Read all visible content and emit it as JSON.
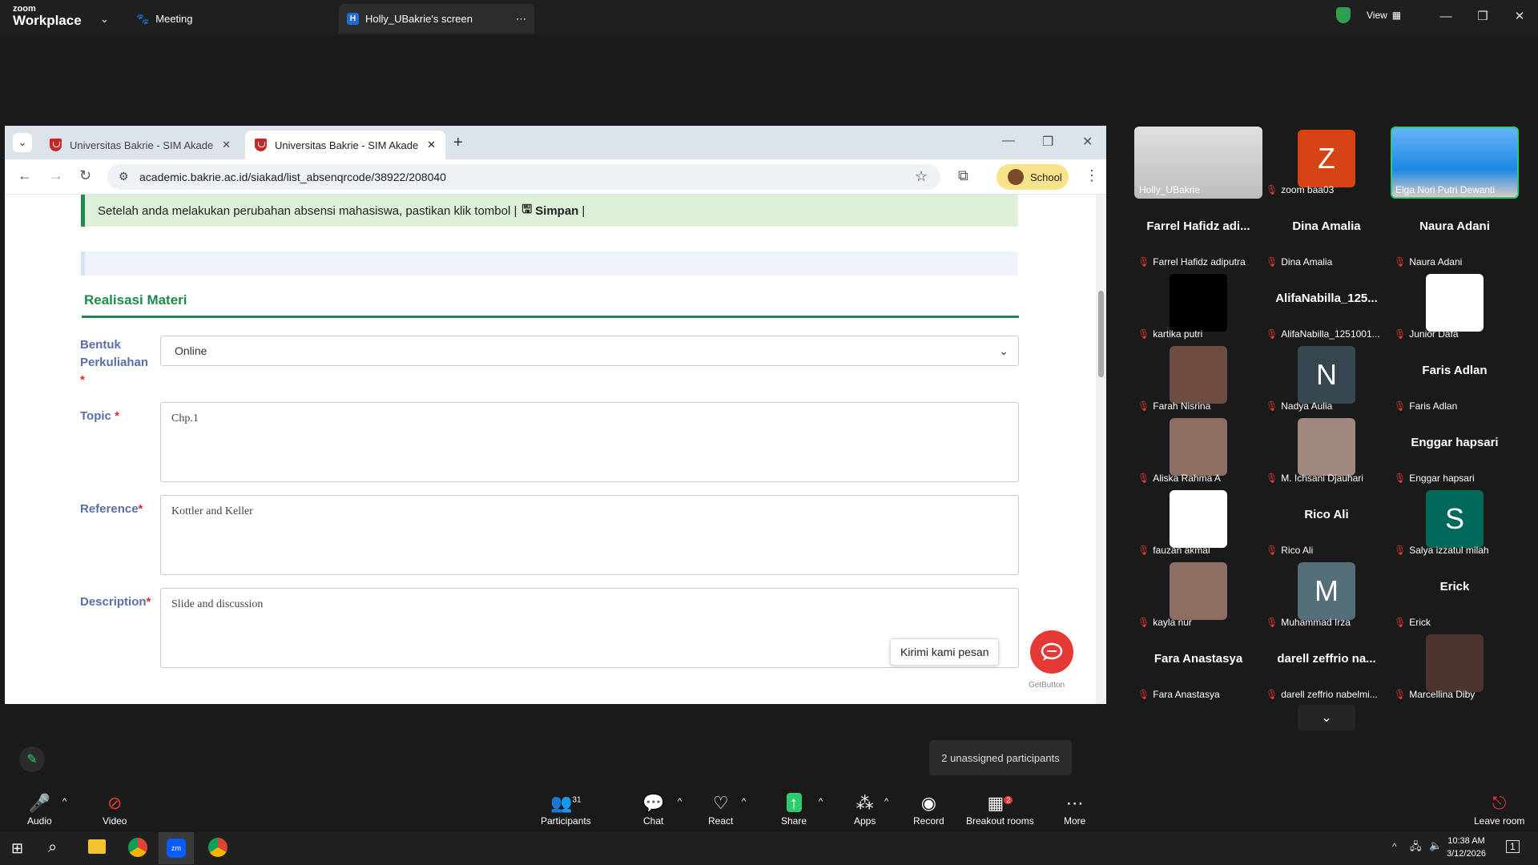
{
  "zoom": {
    "logo_small": "zoom",
    "logo_big": "Workplace",
    "meeting_tab": "Meeting",
    "screen_tab": "Holly_UBakrie's screen",
    "screen_badge": "H",
    "view_label": "View"
  },
  "browser": {
    "tabs": [
      {
        "label": "Universitas Bakrie - SIM Akaden"
      },
      {
        "label": "Universitas Bakrie - SIM Akaden"
      }
    ],
    "url": "academic.bakrie.ac.id/siakad/list_absenqrcode/38922/208040",
    "profile_label": "School"
  },
  "page": {
    "alert_text": "Setelah anda melakukan perubahan absensi mahasiswa, pastikan klik tombol |",
    "alert_button": "Simpan",
    "alert_tail": "|",
    "section_title": "Realisasi Materi",
    "fields": {
      "bentuk_label_1": "Bentuk",
      "bentuk_label_2": "Perkuliahan",
      "bentuk_value": "Online",
      "topic_label": "Topic",
      "topic_value": "Chp.1",
      "reference_label": "Reference",
      "reference_value": "Kottler and Keller",
      "description_label": "Description",
      "description_value": "Slide and discussion",
      "required_mark": "*"
    },
    "chat_tooltip": "Kirimi kami pesan",
    "getbutton_label": "GetButton"
  },
  "participants_gallery": [
    {
      "name": "Holly_UBakrie",
      "tile": "video"
    },
    {
      "name": "zoom baa03",
      "tile": "avatar",
      "letter": "Z",
      "color": "#d84315"
    },
    {
      "name": "Elga Nori Putri Dewanti",
      "tile": "video"
    },
    {
      "name": "Farrel Hafidz adiputra",
      "display": "Farrel  Hafidz adi..."
    },
    {
      "name": "Dina Amalia",
      "display": "Dina Amalia"
    },
    {
      "name": "Naura Adani",
      "display": "Naura Adani"
    },
    {
      "name": "kartika putri",
      "tile": "black"
    },
    {
      "name": "AlifaNabilla_1251001...",
      "display": "AlifaNabilla_125..."
    },
    {
      "name": "Junior Dafa",
      "tile": "white"
    },
    {
      "name": "Farah Nisrina",
      "tile": "photo"
    },
    {
      "name": "Nadya Aulia",
      "tile": "avatar",
      "letter": "N",
      "color": "#37474f"
    },
    {
      "name": "Faris Adlan",
      "display": "Faris Adlan"
    },
    {
      "name": "Aliska Rahma A",
      "tile": "photo"
    },
    {
      "name": "M. Ichsani Djauhari",
      "tile": "photo"
    },
    {
      "name": "Enggar hapsari",
      "display": "Enggar hapsari"
    },
    {
      "name": "fauzan akmal",
      "tile": "white"
    },
    {
      "name": "Rico Ali",
      "display": "Rico Ali"
    },
    {
      "name": "Salya izzatul milah",
      "tile": "avatar",
      "letter": "S",
      "color": "#00695c"
    },
    {
      "name": "kayla nur",
      "tile": "photo"
    },
    {
      "name": "Muhammad Irza",
      "tile": "avatar",
      "letter": "M",
      "color": "#546e7a"
    },
    {
      "name": "Erick",
      "display": "Erick"
    },
    {
      "name": "Fara Anastasya",
      "display": "Fara Anastasya"
    },
    {
      "name": "darell zeffrio nabelmi...",
      "display": "darell  zeffrio  na..."
    },
    {
      "name": "Marcellina Diby",
      "tile": "photo"
    }
  ],
  "unassigned": "2 unassigned participants",
  "controls": {
    "audio": "Audio",
    "video": "Video",
    "participants": "Participants",
    "participants_count": "31",
    "chat": "Chat",
    "react": "React",
    "share": "Share",
    "apps": "Apps",
    "record": "Record",
    "breakout": "Breakout rooms",
    "breakout_badge": "2",
    "more": "More",
    "leave": "Leave room"
  },
  "taskbar": {
    "time": "10:38 AM",
    "date": "3/12/2026",
    "notif_count": "1"
  },
  "colors": {
    "accent_green": "#1e8a4c",
    "label_blue": "#5a6fa8",
    "zoom_bg": "#1a1a1a",
    "mute_red": "#e53935"
  }
}
